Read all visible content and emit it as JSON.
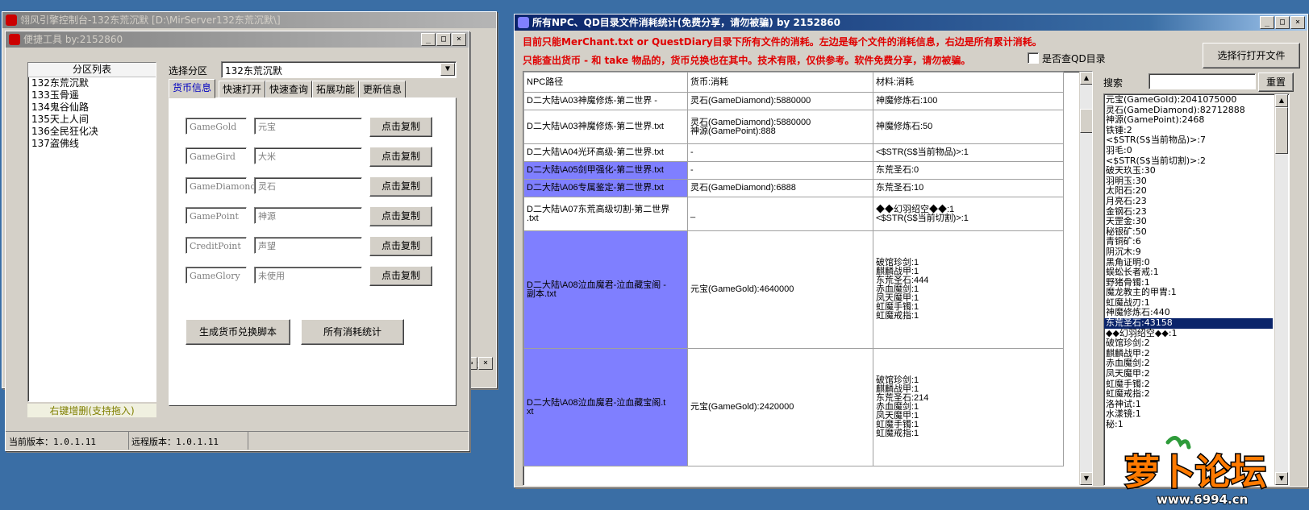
{
  "back_window": {
    "title": "翎风引擎控制台-132东荒沉默 [D:\\MirServer132东荒沉默\\]",
    "partial_label": "默"
  },
  "tool_window": {
    "title": "便捷工具  by:2152860",
    "partition_list_header": "分区列表",
    "partitions": [
      "132东荒沉默",
      "133玉骨遥",
      "134鬼谷仙路",
      "135天上人间",
      "136全民狂化决",
      "137盗佛线"
    ],
    "list_footer": "右键增删(支持拖入)",
    "select_label": "选择分区",
    "select_value": "132东荒沉默",
    "tabs": [
      "货币信息",
      "快速打开",
      "快速查询",
      "拓展功能",
      "更新信息"
    ],
    "currency_rows": [
      {
        "code": "GameGold",
        "name": "元宝",
        "button": "点击复制"
      },
      {
        "code": "GameGird",
        "name": "大米",
        "button": "点击复制"
      },
      {
        "code": "GameDiamond",
        "name": "灵石",
        "button": "点击复制"
      },
      {
        "code": "GamePoint",
        "name": "神源",
        "button": "点击复制"
      },
      {
        "code": "CreditPoint",
        "name": "声望",
        "button": "点击复制"
      },
      {
        "code": "GameGlory",
        "name": "未使用",
        "button": "点击复制"
      }
    ],
    "btn_generate": "生成货币兑换脚本",
    "btn_stats": "所有消耗统计",
    "status_local": "当前版本：1.0.1.11",
    "status_remote": "远程版本：1.0.1.11"
  },
  "stats_window": {
    "title": "所有NPC、QD目录文件消耗统计(免费分享，请勿被骗)    by 2152860",
    "notice_line1": "目前只能MerChant.txt or QuestDiary目录下所有文件的消耗。左边是每个文件的消耗信息，右边是所有累计消耗。",
    "notice_line2": "只能查出货币 - 和 take 物品的，货币兑换也在其中。技术有限，仅供参考。软件免费分享，请勿被骗。",
    "qd_checkbox_label": "是否查QD目录",
    "open_button": "选择行打开文件",
    "columns": [
      "NPC路径",
      "货币:消耗",
      "材料:消耗"
    ],
    "rows": [
      {
        "path": "D二大陆\\A03神魔修炼-第二世界 -",
        "currency": "灵石(GameDiamond):5880000",
        "material": "神魔修炼石:100",
        "hl": false
      },
      {
        "path": "D二大陆\\A03神魔修炼-第二世界.txt",
        "currency": "灵石(GameDiamond):5880000\n神源(GamePoint):888",
        "material": "神魔修炼石:50",
        "hl": false
      },
      {
        "path": "D二大陆\\A04光环高级-第二世界.txt",
        "currency": "-",
        "material": "<$STR(S$当前物品)>:1",
        "hl": false
      },
      {
        "path": "D二大陆\\A05剑甲强化-第二世界.txt",
        "currency": "-",
        "material": "东荒圣石:0",
        "hl": true
      },
      {
        "path": "D二大陆\\A06专属鉴定-第二世界.txt",
        "currency": "灵石(GameDiamond):6888",
        "material": "东荒圣石:10",
        "hl": true
      },
      {
        "path": "D二大陆\\A07东荒高级切割-第二世界\n.txt",
        "currency": "_",
        "material": "◆◆幻羽绍空◆◆:1\n<$STR(S$当前切割)>:1",
        "hl": false
      },
      {
        "path": "D二大陆\\A08泣血魔君-泣血藏宝阁 -\n副本.txt",
        "currency": "元宝(GameGold):4640000",
        "material": "破馆珍剑:1\n麒麟战甲:1\n东荒圣石:444\n赤血魔剑:1\n凤天魔甲:1\n虹魔手镯:1\n虹魔戒指:1",
        "hl": true
      },
      {
        "path": "D二大陆\\A08泣血魔君-泣血藏宝阁.t\nxt",
        "currency": "元宝(GameGold):2420000",
        "material": "破馆珍剑:1\n麒麟战甲:1\n东荒圣石:214\n赤血魔剑:1\n凤天魔甲:1\n虹魔手镯:1\n虹魔戒指:1",
        "hl": true
      }
    ],
    "search_label": "搜索",
    "search_value": "",
    "reset_button": "重置",
    "totals": [
      "元宝(GameGold):2041075000",
      "灵石(GameDiamond):82712888",
      "神源(GamePoint):2468",
      "铁锤:2",
      "<$STR(S$当前物品)>:7",
      "羽毛:0",
      "<$STR(S$当前切割)>:2",
      "破天玖玉:30",
      "羽明玉:30",
      "太阳石:20",
      "月亮石:23",
      "金钢石:23",
      "天罡金:30",
      "秘银矿:50",
      "青铜矿:6",
      "阴沉木:9",
      "黑角证明:0",
      "蜈蚣长者戒:1",
      "野猪骨镯:1",
      "魔龙教主的甲胄:1",
      "虹魔战刃:1",
      "神魔修炼石:440",
      "东荒圣石:43158",
      "◆◆幻羽绍空◆◆:1",
      "破馆珍剑:2",
      "麒麟战甲:2",
      "赤血魔剑:2",
      "凤天魔甲:2",
      "虹魔手镯:2",
      "虹魔戒指:2",
      "洛神试:1",
      "水漾镜:1",
      "秘:1"
    ],
    "selected_total_index": 22
  },
  "watermark": {
    "text": "萝卜论坛",
    "url": "www.6994.cn"
  },
  "colors": {
    "desktop": "#3a6ea5",
    "title_active": "#0a246a",
    "highlight": "#7f7fff",
    "notice_red": "#e00000"
  }
}
